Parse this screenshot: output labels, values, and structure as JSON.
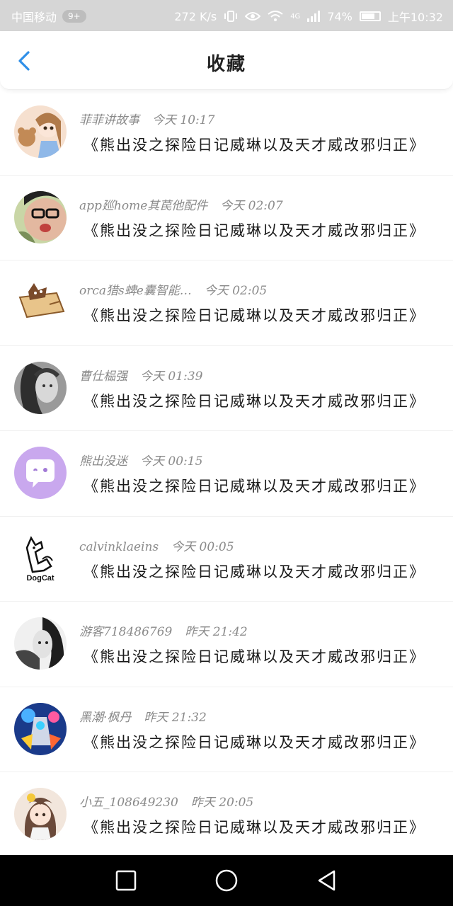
{
  "statusbar": {
    "carrier": "中国移动",
    "pill": "9+",
    "speed": "272 K/s",
    "network": "4G",
    "battery_text": "74%",
    "battery_level": 0.74,
    "time": "上午10:32"
  },
  "header": {
    "title": "收藏",
    "back_icon": "chevron-left-icon"
  },
  "items": [
    {
      "user": "菲菲讲故事",
      "time": "今天 10:17",
      "message": "《熊出没之探险日记威琳以及天才威改邪归正》"
    },
    {
      "user": "app廵home其苠他配件",
      "time": "今天 02:07",
      "message": "《熊出没之探险日记威琳以及天才威改邪归正》"
    },
    {
      "user": "orca猎s蜱e囊智能…",
      "time": "今天 02:05",
      "message": "《熊出没之探险日记威琳以及天才威改邪归正》"
    },
    {
      "user": "曹仕榀强",
      "time": "今天 01:39",
      "message": "《熊出没之探险日记威琳以及天才威改邪归正》"
    },
    {
      "user": "熊出没迷",
      "time": "今天 00:15",
      "message": "《熊出没之探险日记威琳以及天才威改邪归正》"
    },
    {
      "user": "calvinklaeins",
      "time": "今天 00:05",
      "message": "《熊出没之探险日记威琳以及天才威改邪归正》",
      "avatar_label": "DogCat"
    },
    {
      "user": "游客718486769",
      "time": "昨天 21:42",
      "message": "《熊出没之探险日记威琳以及天才威改邪归正》"
    },
    {
      "user": "黑潮·枫丹",
      "time": "昨天 21:32",
      "message": "《熊出没之探险日记威琳以及天才威改邪归正》"
    },
    {
      "user": "小五_108649230",
      "time": "昨天 20:05",
      "message": "《熊出没之探险日记威琳以及天才威改邪归正》"
    }
  ],
  "colors": {
    "accent": "#2f8fe8",
    "statusbar_bg": "#d6d6d6",
    "meta_text": "#8a8a8a"
  },
  "bottom_nav": {
    "icons": [
      "square-recents-icon",
      "circle-home-icon",
      "triangle-back-icon"
    ]
  }
}
